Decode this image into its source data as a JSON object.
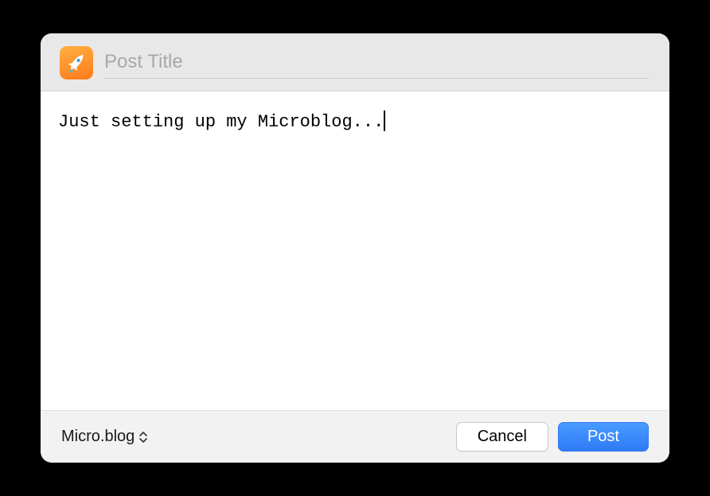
{
  "header": {
    "title_placeholder": "Post Title",
    "title_value": ""
  },
  "body": {
    "text": "Just setting up my Microblog..."
  },
  "footer": {
    "service_label": "Micro.blog",
    "cancel_label": "Cancel",
    "post_label": "Post"
  }
}
